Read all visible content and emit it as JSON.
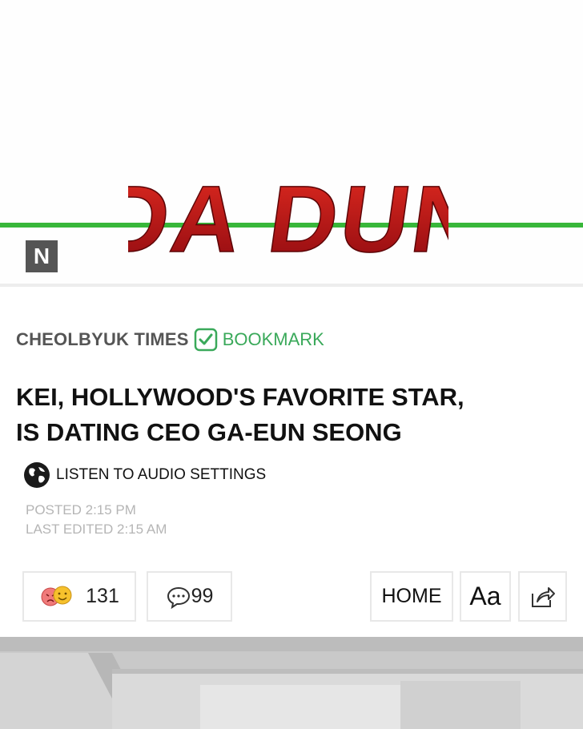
{
  "header": {
    "badge": "N",
    "logo_text": "DA DUN",
    "colors": {
      "green_line": "#38b73a",
      "logo_red": "#c0141a"
    }
  },
  "article": {
    "publisher": "CHEOLBYUK TIMES",
    "bookmark_label": "BOOKMARK",
    "headline_line1": "KEI, HOLLYWOOD'S FAVORITE STAR,",
    "headline_line2": "IS DATING CEO GA-EUN SEONG",
    "audio_label": "LISTEN TO AUDIO SETTINGS",
    "posted": "POSTED 2:15 PM",
    "edited": "LAST EDITED 2:15 AM"
  },
  "actions": {
    "reactions_count": "131",
    "comments_count": "99",
    "home_label": "HOME",
    "font_label": "Aa",
    "icons": [
      "angry-face-icon",
      "smile-face-icon",
      "comment-bubble-icon",
      "share-icon"
    ]
  }
}
